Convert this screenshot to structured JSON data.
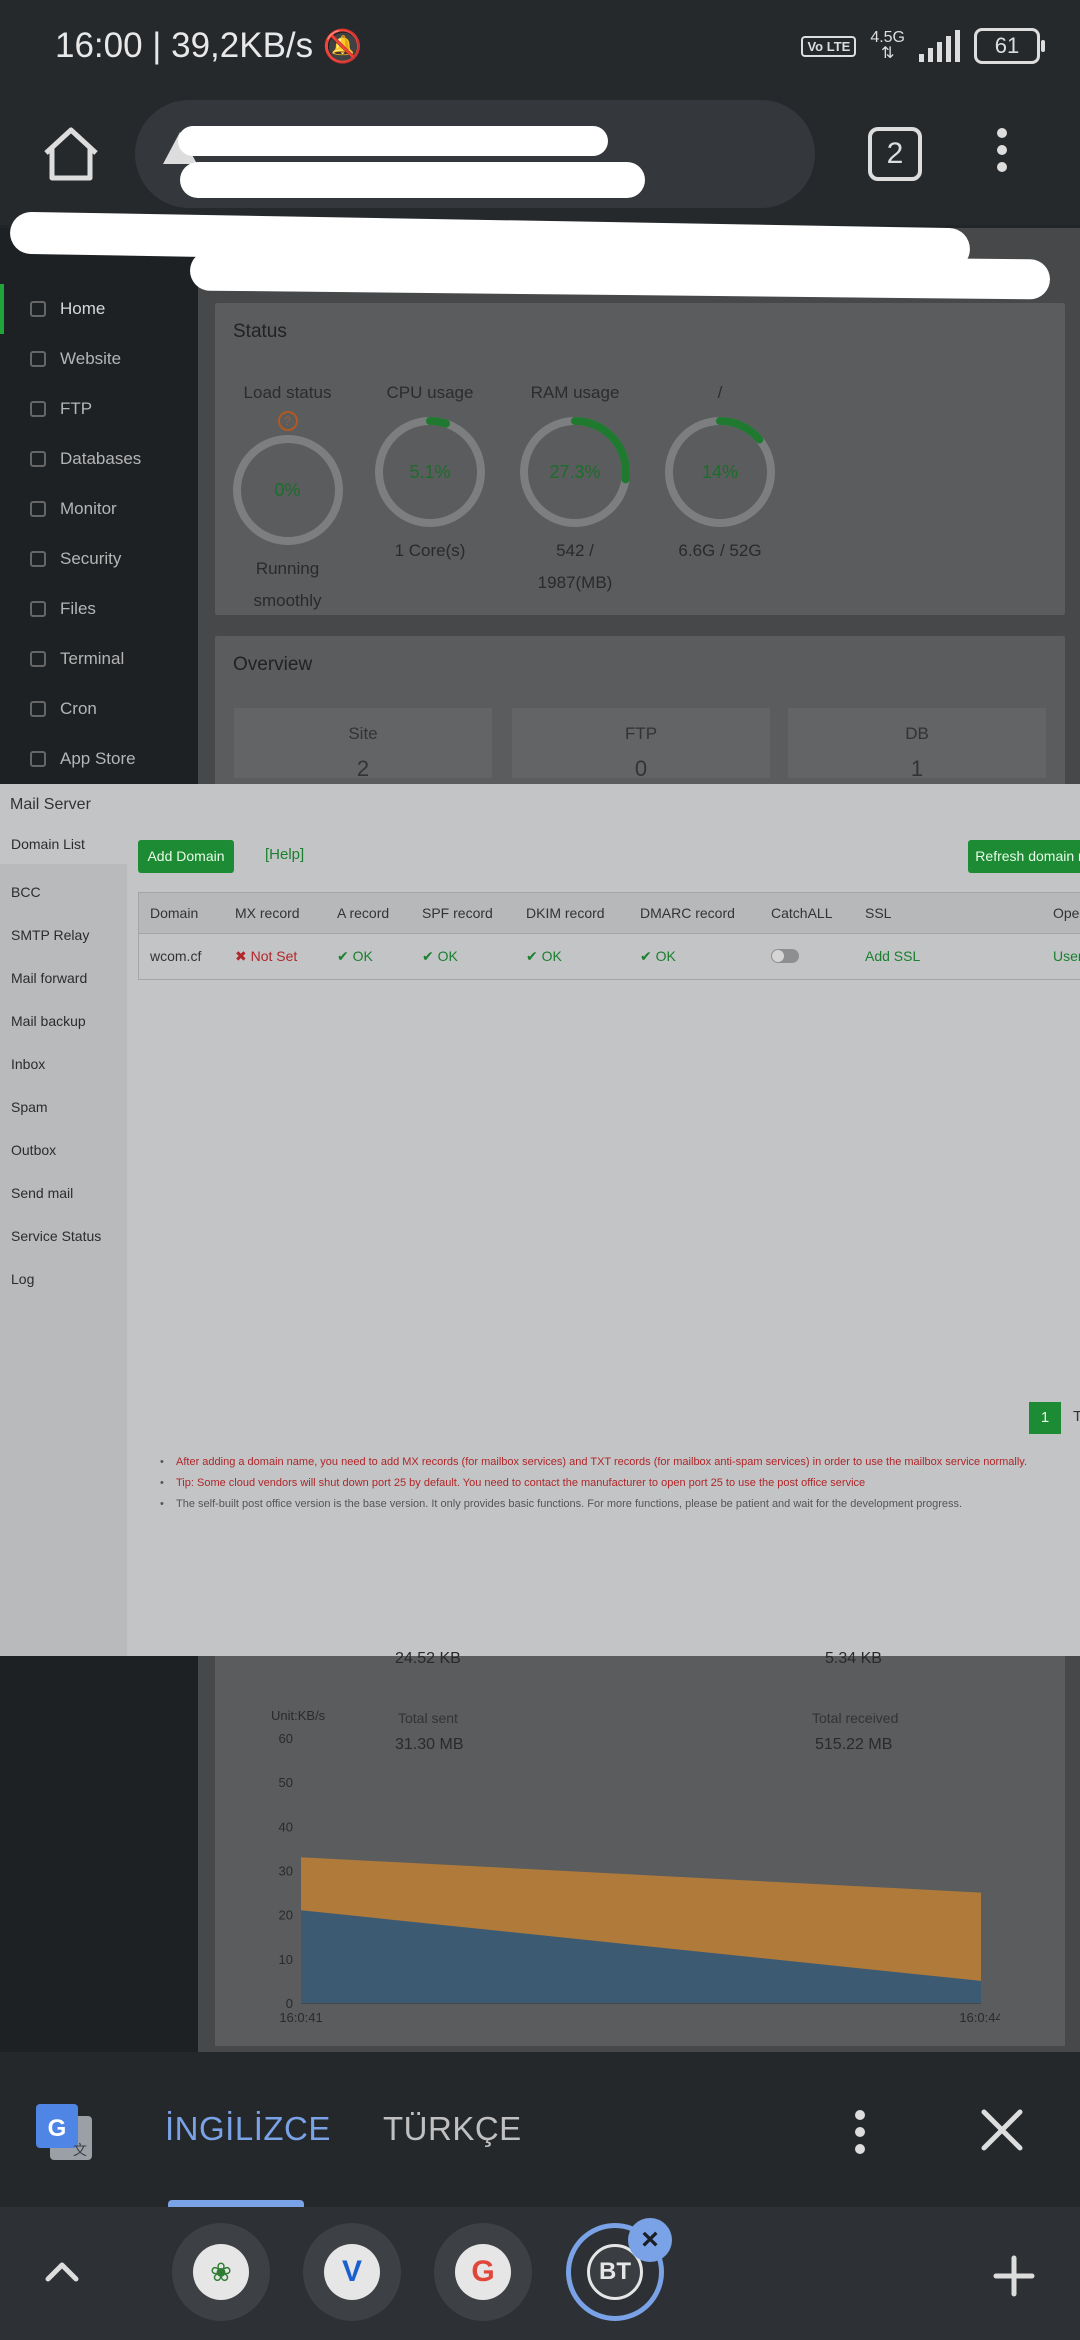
{
  "status_bar": {
    "time_speed": "16:00 | 39,2KB/s",
    "volte": "Vo LTE",
    "network": "4.5G",
    "battery": "61"
  },
  "browser": {
    "tab_count": "2"
  },
  "sidebar": {
    "items": [
      {
        "label": "Home"
      },
      {
        "label": "Website"
      },
      {
        "label": "FTP"
      },
      {
        "label": "Databases"
      },
      {
        "label": "Monitor"
      },
      {
        "label": "Security"
      },
      {
        "label": "Files"
      },
      {
        "label": "Terminal"
      },
      {
        "label": "Cron"
      },
      {
        "label": "App Store"
      }
    ]
  },
  "status_panel": {
    "title": "Status",
    "load": {
      "label": "Load status",
      "value": "0%",
      "sub1": "Running",
      "sub2": "smoothly"
    },
    "cpu": {
      "label": "CPU usage",
      "value": "5.1%",
      "sub1": "1 Core(s)",
      "fill": 0.051
    },
    "ram": {
      "label": "RAM usage",
      "value": "27.3%",
      "sub1": "542 /",
      "sub2": "1987(MB)",
      "fill": 0.273
    },
    "disk": {
      "label": "/",
      "value": "14%",
      "sub1": "6.6G / 52G",
      "fill": 0.14
    }
  },
  "overview": {
    "title": "Overview",
    "tiles": [
      {
        "label": "Site",
        "value": "2"
      },
      {
        "label": "FTP",
        "value": "0"
      },
      {
        "label": "DB",
        "value": "1"
      }
    ]
  },
  "mail_server": {
    "title": "Mail Server",
    "nav": [
      "Domain List",
      "BCC",
      "SMTP Relay",
      "Mail forward",
      "Mail backup",
      "Inbox",
      "Spam",
      "Outbox",
      "Send mail",
      "Service Status",
      "Log"
    ],
    "add_domain": "Add Domain",
    "help": "[Help]",
    "refresh": "Refresh domain r",
    "columns": [
      "Domain",
      "MX record",
      "A record",
      "SPF record",
      "DKIM record",
      "DMARC record",
      "CatchALL",
      "SSL",
      "Oper"
    ],
    "row": {
      "domain": "wcom.cf",
      "mx": "Not Set",
      "a": "OK",
      "spf": "OK",
      "dkim": "OK",
      "dmarc": "OK",
      "ssl": "Add SSL",
      "oper": "User"
    },
    "pager": "1",
    "pager_next": "T",
    "tips": [
      "After adding a domain name, you need to add MX records (for mailbox services) and TXT records (for mailbox anti-spam services) in order to use the mailbox service normally.",
      "Tip: Some cloud vendors will shut down port 25 by default. You need to contact the manufacturer to open port 25 to use the post office service",
      "The self-built post office version is the base version. It only provides basic functions. For more functions, please be patient and wait for the development progress."
    ]
  },
  "traffic": {
    "upstream_value": "24.52 KB",
    "downstream_value": "5.34 KB",
    "unit": "Unit:KB/s",
    "total_sent_label": "Total sent",
    "total_sent": "31.30 MB",
    "total_received_label": "Total received",
    "total_received": "515.22 MB"
  },
  "chart_data": {
    "type": "area",
    "x": [
      "16:0:41",
      "16:0:44"
    ],
    "series": [
      {
        "values": [
          33,
          25
        ],
        "color": "#b07a3a"
      },
      {
        "values": [
          21,
          5
        ],
        "color": "#3d5a73"
      }
    ],
    "xlabel": "",
    "ylabel": "Unit:KB/s",
    "ylim": [
      0,
      60
    ],
    "yticks": [
      "0",
      "10",
      "20",
      "30",
      "40",
      "50",
      "60"
    ],
    "grid": false
  },
  "translate_bar": {
    "lang_selected": "İNGİLİZCE",
    "lang_other": "TÜRKÇE"
  },
  "dock": {
    "active_app": "BT"
  }
}
